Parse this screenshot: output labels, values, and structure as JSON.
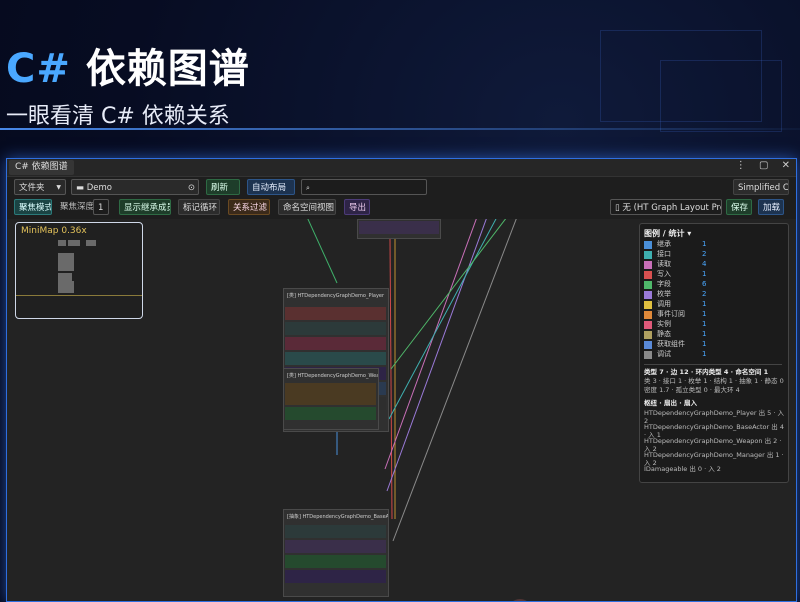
{
  "banner": {
    "title_cs": "C#",
    "title_rest": "依赖图谱",
    "subtitle": "一眼看清 C# 依赖关系"
  },
  "window": {
    "tab": "C# 依赖图谱",
    "icons": [
      "more-icon",
      "maximize-icon",
      "close-icon"
    ]
  },
  "toolbar1": {
    "folder_select": "文件夹",
    "path": "Demo",
    "refresh": "刷新",
    "auto_layout": "自动布局",
    "search_placeholder": "",
    "simplified": "Simplified C▾"
  },
  "toolbar2": {
    "focus_mode": "聚焦模式",
    "focus_depth_label": "聚焦深度",
    "focus_depth_value": "1",
    "show_inherit": "显示继承成员",
    "mark_cycle": "标记循环",
    "relation_filter": "关系过滤",
    "namespace_view": "命名空间视图",
    "export": "导出",
    "layout_select": "无 (HT Graph Layout Pre",
    "save": "保存",
    "load": "加载"
  },
  "minimap": {
    "label": "MiniMap",
    "zoom": "0.36x"
  },
  "nodes": {
    "player": "[类] HTDependencyGraphDemo_Player",
    "weapon": "[类] HTDependencyGraphDemo_Weapon",
    "baseactor": "[抽象] HTDependencyGraphDemo_BaseActor"
  },
  "legend": {
    "header": "图例 / 统计 ▾",
    "items": [
      {
        "name": "继承",
        "count": "1",
        "color": "#4a8fd8"
      },
      {
        "name": "接口",
        "count": "2",
        "color": "#3fb0b0"
      },
      {
        "name": "读取",
        "count": "4",
        "color": "#c86fb8"
      },
      {
        "name": "写入",
        "count": "1",
        "color": "#d85050"
      },
      {
        "name": "字段",
        "count": "6",
        "color": "#4fb86a"
      },
      {
        "name": "枚举",
        "count": "2",
        "color": "#9a7ad8"
      },
      {
        "name": "调用",
        "count": "1",
        "color": "#e0c040"
      },
      {
        "name": "事件订阅",
        "count": "1",
        "color": "#e08a3a"
      },
      {
        "name": "实例",
        "count": "1",
        "color": "#e05a7a"
      },
      {
        "name": "静态",
        "count": "1",
        "color": "#b0a060"
      },
      {
        "name": "获取组件",
        "count": "1",
        "color": "#5a8ad8"
      },
      {
        "name": "调试",
        "count": "1",
        "color": "#8a8a8a"
      }
    ],
    "stats1": "类型 7 · 边 12 · 环内类型 4 · 命名空间 1",
    "stats2": "类 3 · 接口 1 · 枚举 1 · 结构 1 · 抽象 1 · 静态 0",
    "stats3": "密度 1.7 · 孤立类型 0 · 最大环 4",
    "hub_header": "枢纽 · 扇出 · 扇入",
    "hubs": [
      "HTDependencyGraphDemo_Player 出 5 · 入 2",
      "HTDependencyGraphDemo_BaseActor 出 4 · 入 1",
      "HTDependencyGraphDemo_Weapon 出 2 · 入 2",
      "HTDependencyGraphDemo_Manager 出 1 · 入 2",
      "IDamageable 出 0 · 入 2"
    ]
  }
}
